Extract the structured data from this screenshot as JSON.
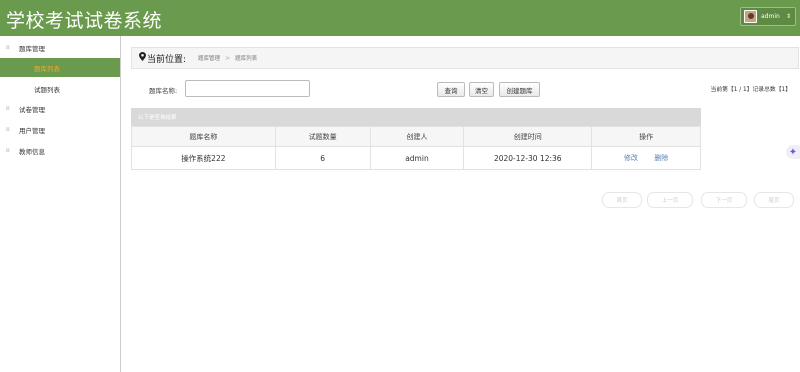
{
  "app": {
    "title": "学校考试试卷系统"
  },
  "user": {
    "name": "admin",
    "caret": "⇕"
  },
  "sidebar": {
    "items": [
      {
        "label": "题库管理"
      },
      {
        "label": "题库列表"
      },
      {
        "label": "试题列表"
      },
      {
        "label": "试卷管理"
      },
      {
        "label": "用户管理"
      },
      {
        "label": "教师信息"
      }
    ]
  },
  "breadcrumb": {
    "here": "当前位置:",
    "level1": "题库管理",
    "sep": ">",
    "level2": "题库列表"
  },
  "search": {
    "label": "题库名称:",
    "value": "",
    "query_btn": "查询",
    "clear_btn": "清空",
    "create_btn": "创建题库"
  },
  "record_info": "当前第【1 / 1】记录总数【1】",
  "result_bar": "以下是查询结果",
  "table": {
    "headers": [
      "题库名称",
      "试题数量",
      "创建人",
      "创建时间",
      "操作"
    ],
    "rows": [
      {
        "name": "操作系统222",
        "count": "6",
        "creator": "admin",
        "created": "2020-12-30 12:36",
        "edit": "修改",
        "delete": "删除"
      }
    ]
  },
  "pager": {
    "first": "首页",
    "prev": "上一页",
    "next": "下一页",
    "last": "尾页"
  },
  "colors": {
    "brand": "#6a9a4d",
    "active_text": "#f0a830",
    "link": "#5b7fb0"
  }
}
